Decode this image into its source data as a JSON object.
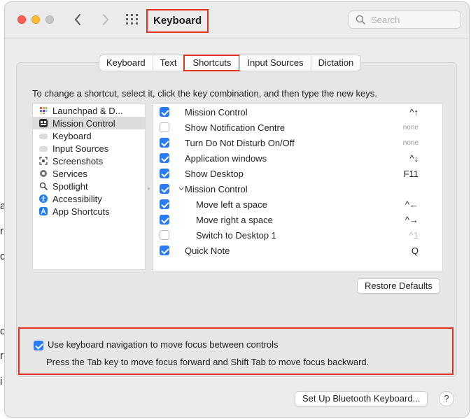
{
  "background": {
    "fragments": [
      "a",
      "r",
      "c",
      "o",
      "r",
      "i"
    ]
  },
  "window": {
    "title": "Keyboard",
    "search": {
      "placeholder": "Search"
    }
  },
  "tabs": [
    {
      "label": "Keyboard",
      "selected": false
    },
    {
      "label": "Text",
      "selected": false
    },
    {
      "label": "Shortcuts",
      "selected": true
    },
    {
      "label": "Input Sources",
      "selected": false
    },
    {
      "label": "Dictation",
      "selected": false
    }
  ],
  "instruction": "To change a shortcut, select it, click the key combination, and then type the new keys.",
  "categories": [
    {
      "label": "Launchpad & D...",
      "icon": "launchpad-icon",
      "color": "#d9a64a"
    },
    {
      "label": "Mission Control",
      "icon": "mission-control-icon",
      "color": "#333333",
      "selected": true
    },
    {
      "label": "Keyboard",
      "icon": "keyboard-icon",
      "color": "#c4c4c4"
    },
    {
      "label": "Input Sources",
      "icon": "input-sources-icon",
      "color": "#c4c4c4"
    },
    {
      "label": "Screenshots",
      "icon": "screenshots-icon",
      "color": "#555555"
    },
    {
      "label": "Services",
      "icon": "services-icon",
      "color": "#777777"
    },
    {
      "label": "Spotlight",
      "icon": "spotlight-icon",
      "color": "#555555"
    },
    {
      "label": "Accessibility",
      "icon": "accessibility-icon",
      "color": "#1f7cf0"
    },
    {
      "label": "App Shortcuts",
      "icon": "app-shortcuts-icon",
      "color": "#1f7cf0"
    }
  ],
  "shortcuts": [
    {
      "name": "Mission Control",
      "key": "^↑",
      "checked": true
    },
    {
      "name": "Show Notification Centre",
      "key": "none",
      "checked": false
    },
    {
      "name": "Turn Do Not Disturb On/Off",
      "key": "none",
      "checked": true
    },
    {
      "name": "Application windows",
      "key": "^↓",
      "checked": true
    },
    {
      "name": "Show Desktop",
      "key": "F11",
      "checked": true
    },
    {
      "name": "Mission Control",
      "key": "",
      "checked": true,
      "group": true
    },
    {
      "name": "Move left a space",
      "key": "^←",
      "checked": true,
      "indent": true
    },
    {
      "name": "Move right a space",
      "key": "^→",
      "checked": true,
      "indent": true
    },
    {
      "name": "Switch to Desktop 1",
      "key": "^1",
      "checked": false,
      "indent": true
    },
    {
      "name": "Quick Note",
      "key": "Q",
      "checked": true
    }
  ],
  "buttons": {
    "restore_defaults": "Restore Defaults",
    "bluetooth": "Set Up Bluetooth Keyboard...",
    "help": "?"
  },
  "keyboard_navigation": {
    "checked": true,
    "label": "Use keyboard navigation to move focus between controls",
    "hint": "Press the Tab key to move focus forward and Shift Tab to move focus backward."
  },
  "colors": {
    "accent": "#2a7cf6",
    "highlight": "#e0321c"
  }
}
